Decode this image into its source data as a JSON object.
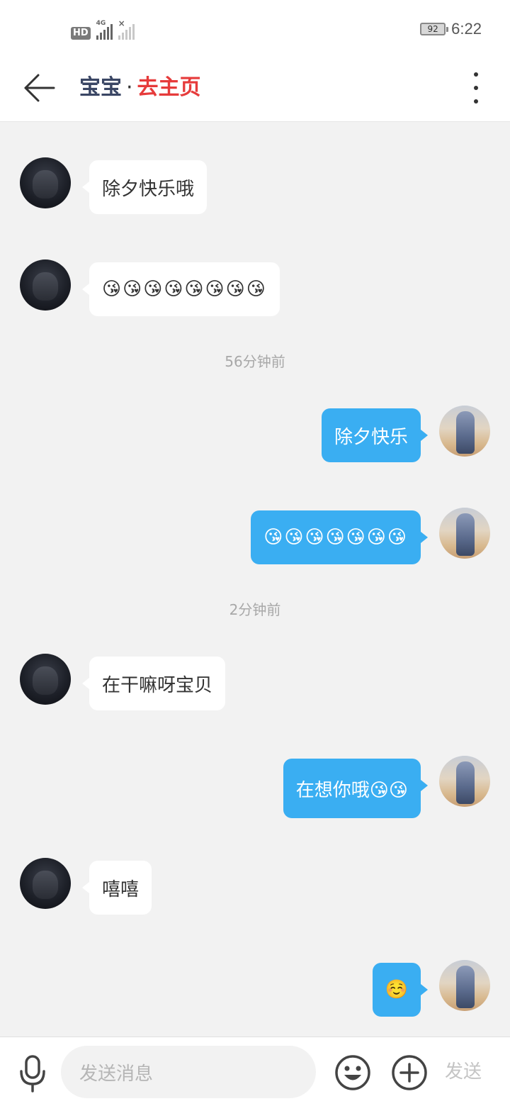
{
  "status_bar": {
    "hd_label": "HD",
    "network_label": "4G",
    "battery_level": "92",
    "time": "6:22"
  },
  "header": {
    "contact_name": "宝宝",
    "separator": "·",
    "homepage_link": "去主页",
    "back_icon": "arrow-left-icon",
    "more_icon": "more-vertical-icon"
  },
  "messages": [
    {
      "sender": "partner",
      "text": "除夕快乐哦"
    },
    {
      "sender": "partner",
      "text": "😘😘😘😘😘😘😘😘"
    },
    {
      "type": "timestamp",
      "text": "56分钟前"
    },
    {
      "sender": "me",
      "text": "除夕快乐"
    },
    {
      "sender": "me",
      "text": "😘😘😘😘😘😘😘"
    },
    {
      "type": "timestamp",
      "text": "2分钟前"
    },
    {
      "sender": "partner",
      "text": "在干嘛呀宝贝"
    },
    {
      "sender": "me",
      "text": "在想你哦😘😘"
    },
    {
      "sender": "partner",
      "text": "嘻嘻"
    },
    {
      "sender": "me",
      "text": "☺️"
    }
  ],
  "input_bar": {
    "placeholder": "发送消息",
    "send_label": "发送",
    "voice_icon": "microphone-icon",
    "emoji_icon": "smiley-icon",
    "plus_icon": "plus-circle-icon"
  },
  "colors": {
    "my_bubble": "#3aaef2",
    "partner_bubble": "#ffffff",
    "homepage_link": "#e63b3b",
    "background": "#f2f2f2"
  }
}
